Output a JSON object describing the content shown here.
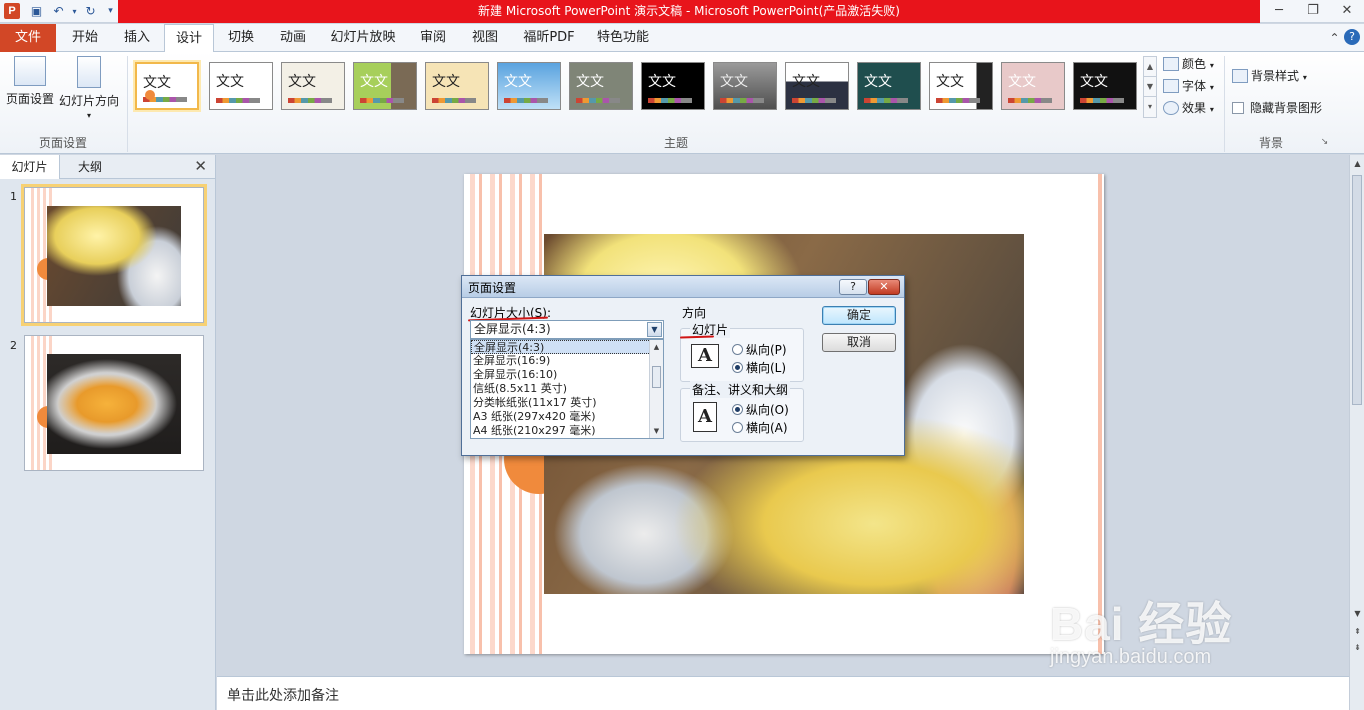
{
  "window": {
    "title": "新建 Microsoft PowerPoint 演示文稿 - Microsoft PowerPoint(产品激活失败)",
    "app_logo": "P"
  },
  "ribbon_tabs": [
    "文件",
    "开始",
    "插入",
    "设计",
    "切换",
    "动画",
    "幻灯片放映",
    "审阅",
    "视图",
    "福昕PDF",
    "特色功能"
  ],
  "active_tab": "设计",
  "ribbon": {
    "page_setup_btn": "页面设置",
    "orientation_btn": "幻灯片方向",
    "group_page_setup": "页面设置",
    "group_themes": "主题",
    "group_background": "背景",
    "theme_sample_text": "文文",
    "colors": "颜色",
    "fonts": "字体",
    "effects": "效果",
    "bg_styles": "背景样式",
    "hide_bg": "隐藏背景图形"
  },
  "left_pane": {
    "tab_slides": "幻灯片",
    "tab_outline": "大纲",
    "slide_numbers": [
      "1",
      "2"
    ]
  },
  "notes_placeholder": "单击此处添加备注",
  "dialog": {
    "title": "页面设置",
    "help": "?",
    "slide_size_label": "幻灯片大小(S):",
    "selected_size": "全屏显示(4:3)",
    "size_options": [
      "全屏显示(4:3)",
      "全屏显示(16:9)",
      "全屏显示(16:10)",
      "信纸(8.5x11 英寸)",
      "分类帐纸张(11x17 英寸)",
      "A3 纸张(297x420 毫米)",
      "A4 纸张(210x297 毫米)"
    ],
    "orientation_label": "方向",
    "slides_label": "幻灯片",
    "portrait_p": "纵向(P)",
    "landscape_l": "横向(L)",
    "notes_label": "备注、讲义和大纲",
    "portrait_o": "纵向(O)",
    "landscape_a": "横向(A)",
    "ok": "确定",
    "cancel": "取消",
    "slides_orientation": "landscape",
    "notes_orientation": "portrait"
  },
  "watermark": {
    "brand": "Bai 经验",
    "url": "jingyan.baidu.com"
  },
  "colors": {
    "title_red": "#e8141b",
    "file_tab": "#d24726",
    "accent_orange": "#f08a3c"
  }
}
